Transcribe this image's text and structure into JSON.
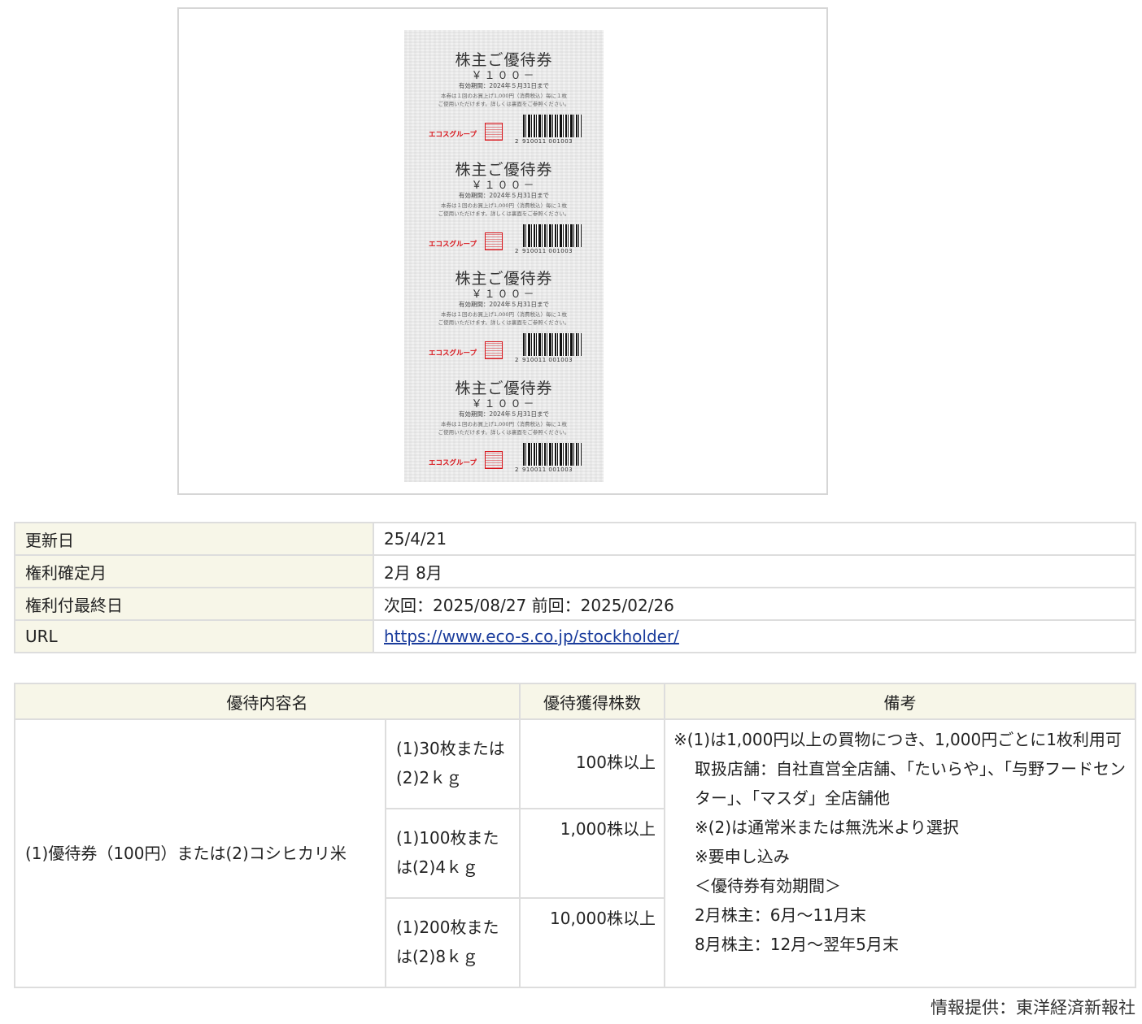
{
  "coupon_image": {
    "title": "株主ご優待券",
    "amount": "￥１００－",
    "expiry": "有効期間：2024年５月31日まで",
    "note_line1": "本券は１回のお買上げ1,000円（消費税込）毎に１枚",
    "note_line2": "ご使用いただけます。詳しくは裏面をご参照ください。",
    "logo": "エコスグループ",
    "code_lead": "2",
    "code": "910011 001003"
  },
  "info": {
    "rows": [
      {
        "label": "更新日",
        "value": "25/4/21"
      },
      {
        "label": "権利確定月",
        "value": "2月 8月"
      },
      {
        "label": "権利付最終日",
        "value": "次回：2025/08/27 前回：2025/02/26"
      },
      {
        "label": "URL",
        "value": "https://www.eco-s.co.jp/stockholder/"
      }
    ]
  },
  "benefits": {
    "headers": {
      "name": "優待内容名",
      "shares": "優待獲得株数",
      "remarks": "備考"
    },
    "name": "(1)優待券（100円）または(2)コシヒカリ米",
    "rows": [
      {
        "qty": "(1)30枚または(2)2ｋｇ",
        "shares": "100株以上"
      },
      {
        "qty": "(1)100枚または(2)4ｋｇ",
        "shares": "1,000株以上"
      },
      {
        "qty": "(1)200枚または(2)8ｋｇ",
        "shares": "10,000株以上"
      }
    ],
    "remarks": {
      "l1": "※(1)は1,000円以上の買物につき、1,000円ごとに1枚利用可",
      "l2": "取扱店舗：自社直営全店舗、「たいらや」、「与野フードセンター」、「マスダ」全店舗他",
      "l3": "※(2)は通常米または無洗米より選択",
      "l4": "※要申し込み",
      "l5": "＜優待券有効期間＞",
      "l6": "2月株主：6月〜11月末",
      "l7": "8月株主：12月〜翌年5月末"
    }
  },
  "credit": "情報提供：東洋経済新報社"
}
